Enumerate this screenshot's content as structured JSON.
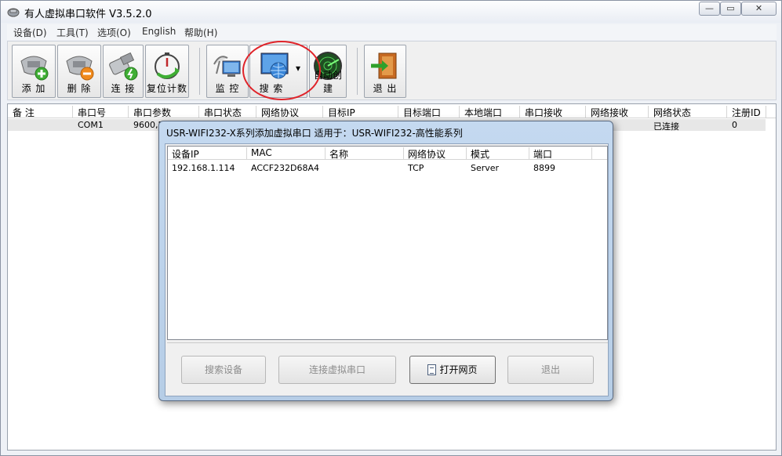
{
  "window": {
    "title": "有人虚拟串口软件 V3.5.2.0",
    "min_glyph": "—",
    "max_glyph": "▭",
    "close_glyph": "✕"
  },
  "menu": [
    "设备(D)",
    "工具(T)",
    "选项(O)",
    "English",
    "帮助(H)"
  ],
  "toolbar": {
    "add": "添 加",
    "delete": "删 除",
    "connect": "连 接",
    "reset_count": "复位计数",
    "monitor": "监 控",
    "search": "搜 索",
    "search_dropdown_glyph": "▾",
    "auto_create": "自动创建",
    "exit": "退 出"
  },
  "port_table": {
    "columns": [
      "备 注",
      "串口号",
      "串口参数",
      "串口状态",
      "网络协议",
      "目标IP",
      "目标端口",
      "本地端口",
      "串口接收",
      "网络接收",
      "网络状态",
      "注册ID"
    ],
    "rows": [
      {
        "port": "COM1",
        "params": "9600,E",
        "net_status": "已连接",
        "reg_id": "0"
      }
    ]
  },
  "dialog": {
    "title": "USR-WIFI232-X系列添加虚拟串口  适用于：USR-WIFI232-高性能系列",
    "columns": [
      "设备IP",
      "MAC",
      "名称",
      "网络协议",
      "模式",
      "端口"
    ],
    "rows": [
      {
        "ip": "192.168.1.114",
        "mac": "ACCF232D68A4",
        "name": "",
        "protocol": "TCP",
        "mode": "Server",
        "port": "8899"
      }
    ],
    "buttons": {
      "search_device": "搜索设备",
      "connect_virtual": "连接虚拟串口",
      "open_webpage": "打开网页",
      "exit": "退出"
    }
  }
}
